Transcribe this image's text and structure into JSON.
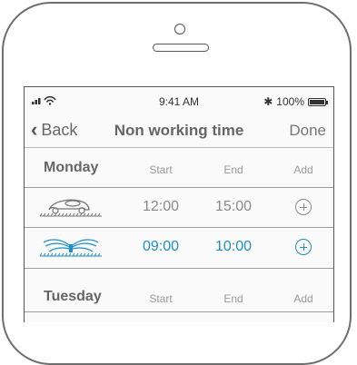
{
  "status_bar": {
    "time": "9:41 AM",
    "battery": "100%"
  },
  "nav": {
    "back_label": "Back",
    "title": "Non working time",
    "done_label": "Done"
  },
  "columns": {
    "start": "Start",
    "end": "End",
    "add": "Add"
  },
  "days": [
    {
      "name": "Monday",
      "rows": [
        {
          "device": "mower",
          "start": "12:00",
          "end": "15:00",
          "color": "#8a8a8a"
        },
        {
          "device": "sprinkler",
          "start": "09:00",
          "end": "10:00",
          "color": "#1f8fc5"
        }
      ]
    },
    {
      "name": "Tuesday",
      "rows": []
    }
  ]
}
